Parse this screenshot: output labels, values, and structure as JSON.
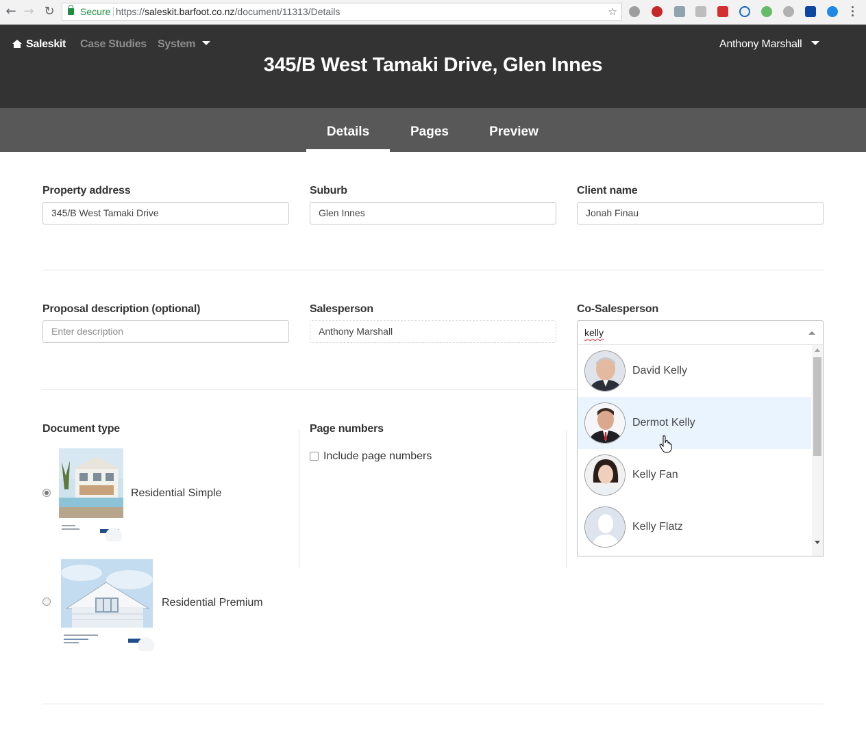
{
  "browser": {
    "secure_label": "Secure",
    "url_prefix": "https://",
    "url_host": "saleskit.barfoot.co.nz",
    "url_path": "/document/11313/Details"
  },
  "nav": {
    "brand": "Saleskit",
    "case_studies": "Case Studies",
    "system": "System",
    "user": "Anthony Marshall"
  },
  "document": {
    "title": "345/B West Tamaki Drive, Glen Innes"
  },
  "tabs": [
    {
      "label": "Details",
      "active": true
    },
    {
      "label": "Pages",
      "active": false
    },
    {
      "label": "Preview",
      "active": false
    }
  ],
  "form": {
    "property_address": {
      "label": "Property address",
      "value": "345/B West Tamaki Drive"
    },
    "suburb": {
      "label": "Suburb",
      "value": "Glen Innes"
    },
    "client_name": {
      "label": "Client name",
      "value": "Jonah Finau"
    },
    "proposal_description": {
      "label": "Proposal description (optional)",
      "placeholder": "Enter description"
    },
    "salesperson": {
      "label": "Salesperson",
      "value": "Anthony Marshall"
    },
    "co_salesperson": {
      "label": "Co-Salesperson",
      "search": "kelly",
      "options": [
        {
          "name": "David Kelly",
          "avatar": "photo-man-grey-hair"
        },
        {
          "name": "Dermot Kelly",
          "avatar": "photo-man-suit",
          "highlighted": true
        },
        {
          "name": "Kelly Fan",
          "avatar": "photo-woman"
        },
        {
          "name": "Kelly Flatz",
          "avatar": "placeholder-silhouette"
        }
      ]
    },
    "document_type": {
      "label": "Document type",
      "options": [
        {
          "label": "Residential Simple",
          "selected": true
        },
        {
          "label": "Residential Premium",
          "selected": false
        }
      ]
    },
    "page_numbers": {
      "label": "Page numbers",
      "checkbox_label": "Include page numbers",
      "checked": false
    }
  },
  "colors": {
    "header_bg": "#333333",
    "tabbar_bg": "#585858",
    "hover_row": "#e9f4fe",
    "secure_green": "#1e8e3e"
  }
}
